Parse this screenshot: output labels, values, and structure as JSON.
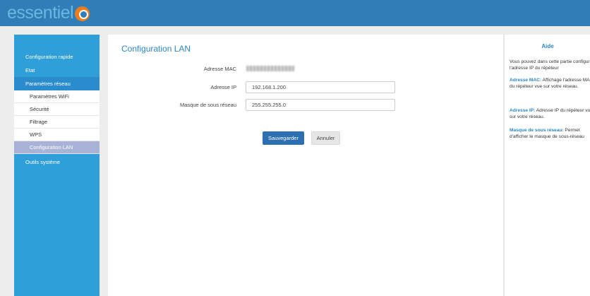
{
  "brand": {
    "logo_text": "essentiel"
  },
  "sidebar": {
    "items": [
      {
        "label": "Configuration rapide"
      },
      {
        "label": "Etat"
      },
      {
        "label": "Paramètres réseau"
      }
    ],
    "subitems": [
      {
        "label": "Paramètres WiFi"
      },
      {
        "label": "Sécurité"
      },
      {
        "label": "Filtrage"
      },
      {
        "label": "WPS"
      },
      {
        "label": "Configuration LAN"
      }
    ],
    "system": {
      "label": "Outils système"
    }
  },
  "main": {
    "title": "Configuration LAN",
    "mac": {
      "label": "Adresse MAC"
    },
    "ip": {
      "label": "Adresse IP",
      "value": "192.168.1.200"
    },
    "mask": {
      "label": "Masque de sous réseau",
      "value": "255.255.255.0"
    },
    "save_label": "Sauvegarder",
    "cancel_label": "Annuler"
  },
  "help": {
    "title": "Aide",
    "intro": "Vous pouvez dans cette partie configurer l'adresse IP du répéteur",
    "mac_term": "Adresse MAC:",
    "mac_text": " Affichage l'adresse MAC du répéteur vue sur votre réseau.",
    "ip_term": "Adresse IP:",
    "ip_text": " Adresse IP du répéteur vue sur votre réseau.",
    "mask_term": "Masque de sous réseau:",
    "mask_text": " Permet d'afficher le masque de sous-réseau"
  },
  "colors": {
    "topbar": "#2f7eb8",
    "sidebar": "#2e9fd8",
    "accent": "#2e86c1",
    "selected_item": "#a9b3d8",
    "logo_badge": "#f07d1b"
  }
}
